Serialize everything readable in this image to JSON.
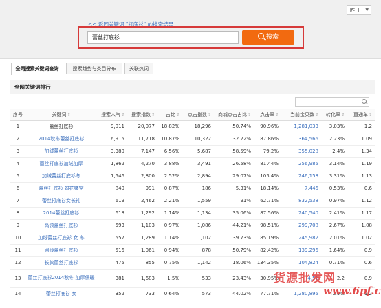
{
  "date_select": {
    "value": "昨日"
  },
  "back_link": "<< 返回关键词 \"打底衫\" 的搜索结果",
  "search": {
    "value": "蕾丝打底衫",
    "button_label": "搜索"
  },
  "tabs": [
    {
      "label": "全网搜索关键词查询",
      "active": true
    },
    {
      "label": "搜索趋势与类目分布",
      "active": false
    },
    {
      "label": "关联热词",
      "active": false
    }
  ],
  "panel_title": "全网关键词排行",
  "columns": [
    "序号",
    "关键词",
    "搜索人气",
    "搜索指数",
    "占比",
    "点击指数",
    "商城点击占比",
    "点击率",
    "当前宝贝数",
    "转化率",
    "直通车"
  ],
  "rows": [
    {
      "n": "1",
      "kw": "蕾丝打底衫",
      "c1": "9,011",
      "c2": "20,077",
      "c3": "18.82%",
      "c4": "18,296",
      "c5": "50.74%",
      "c6": "90.96%",
      "c7": "1,281,033",
      "c8": "3.03%",
      "c9": "1.2"
    },
    {
      "n": "2",
      "kw": "2014秋冬蕾丝打底衫",
      "c1": "6,915",
      "c2": "11,718",
      "c3": "10.87%",
      "c4": "10,322",
      "c5": "32.22%",
      "c6": "87.86%",
      "c7": "364,566",
      "c8": "2.23%",
      "c9": "1.09"
    },
    {
      "n": "3",
      "kw": "加绒蕾丝打底衫",
      "c1": "3,380",
      "c2": "7,147",
      "c3": "6.56%",
      "c4": "5,687",
      "c5": "58.59%",
      "c6": "79.2%",
      "c7": "355,028",
      "c8": "2.4%",
      "c9": "1.34"
    },
    {
      "n": "4",
      "kw": "蕾丝打底衫加绒加厚",
      "c1": "1,862",
      "c2": "4,270",
      "c3": "3.88%",
      "c4": "3,491",
      "c5": "26.58%",
      "c6": "81.44%",
      "c7": "256,985",
      "c8": "3.14%",
      "c9": "1.19"
    },
    {
      "n": "5",
      "kw": "加绒蕾丝打底衫冬",
      "c1": "1,546",
      "c2": "2,800",
      "c3": "2.52%",
      "c4": "2,894",
      "c5": "29.07%",
      "c6": "103.4%",
      "c7": "246,158",
      "c8": "3.31%",
      "c9": "1.13"
    },
    {
      "n": "6",
      "kw": "蕾丝打底衫 勾花镂空",
      "c1": "840",
      "c2": "991",
      "c3": "0.87%",
      "c4": "186",
      "c5": "5.31%",
      "c6": "18.14%",
      "c7": "7,446",
      "c8": "0.53%",
      "c9": "0.6"
    },
    {
      "n": "7",
      "kw": "蕾丝打底衫女长袖",
      "c1": "619",
      "c2": "2,462",
      "c3": "2.21%",
      "c4": "1,559",
      "c5": "91%",
      "c6": "62.71%",
      "c7": "832,538",
      "c8": "0.97%",
      "c9": "1.12"
    },
    {
      "n": "8",
      "kw": "2014蕾丝打底衫",
      "c1": "618",
      "c2": "1,292",
      "c3": "1.14%",
      "c4": "1,134",
      "c5": "35.06%",
      "c6": "87.56%",
      "c7": "240,540",
      "c8": "2.41%",
      "c9": "1.17"
    },
    {
      "n": "9",
      "kw": "高领蕾丝打底衫",
      "c1": "593",
      "c2": "1,103",
      "c3": "0.97%",
      "c4": "1,086",
      "c5": "44.21%",
      "c6": "98.51%",
      "c7": "299,708",
      "c8": "2.67%",
      "c9": "1.08"
    },
    {
      "n": "10",
      "kw": "加绒蕾丝打底衫 女 冬",
      "c1": "557",
      "c2": "1,289",
      "c3": "1.14%",
      "c4": "1,102",
      "c5": "39.73%",
      "c6": "85.19%",
      "c7": "245,982",
      "c8": "2.01%",
      "c9": "1.02"
    },
    {
      "n": "11",
      "kw": "网纱蕾丝打底衫",
      "c1": "516",
      "c2": "1,061",
      "c3": "0.94%",
      "c4": "878",
      "c5": "50.79%",
      "c6": "82.42%",
      "c7": "139,296",
      "c8": "1.64%",
      "c9": "0.9"
    },
    {
      "n": "12",
      "kw": "长款蕾丝打底衫",
      "c1": "475",
      "c2": "855",
      "c3": "0.75%",
      "c4": "1,142",
      "c5": "18.06%",
      "c6": "134.35%",
      "c7": "104,824",
      "c8": "0.71%",
      "c9": "0.6"
    },
    {
      "n": "13",
      "kw": "蕾丝打底衫2014秋冬 加厚保暖",
      "c1": "381",
      "c2": "1,683",
      "c3": "1.5%",
      "c4": "533",
      "c5": "23.43%",
      "c6": "30.95%",
      "c7": "4,51",
      "c8": "2.2",
      "c9": "0.9"
    },
    {
      "n": "14",
      "kw": "蕾丝打底衫 女",
      "c1": "352",
      "c2": "733",
      "c3": "0.64%",
      "c4": "573",
      "c5": "44.02%",
      "c6": "77.71%",
      "c7": "1,280,895",
      "c8": "4.89%",
      "c9": "1.2"
    }
  ],
  "watermark": {
    "text": "货源批发网",
    "url": "www.6pf.cn"
  }
}
